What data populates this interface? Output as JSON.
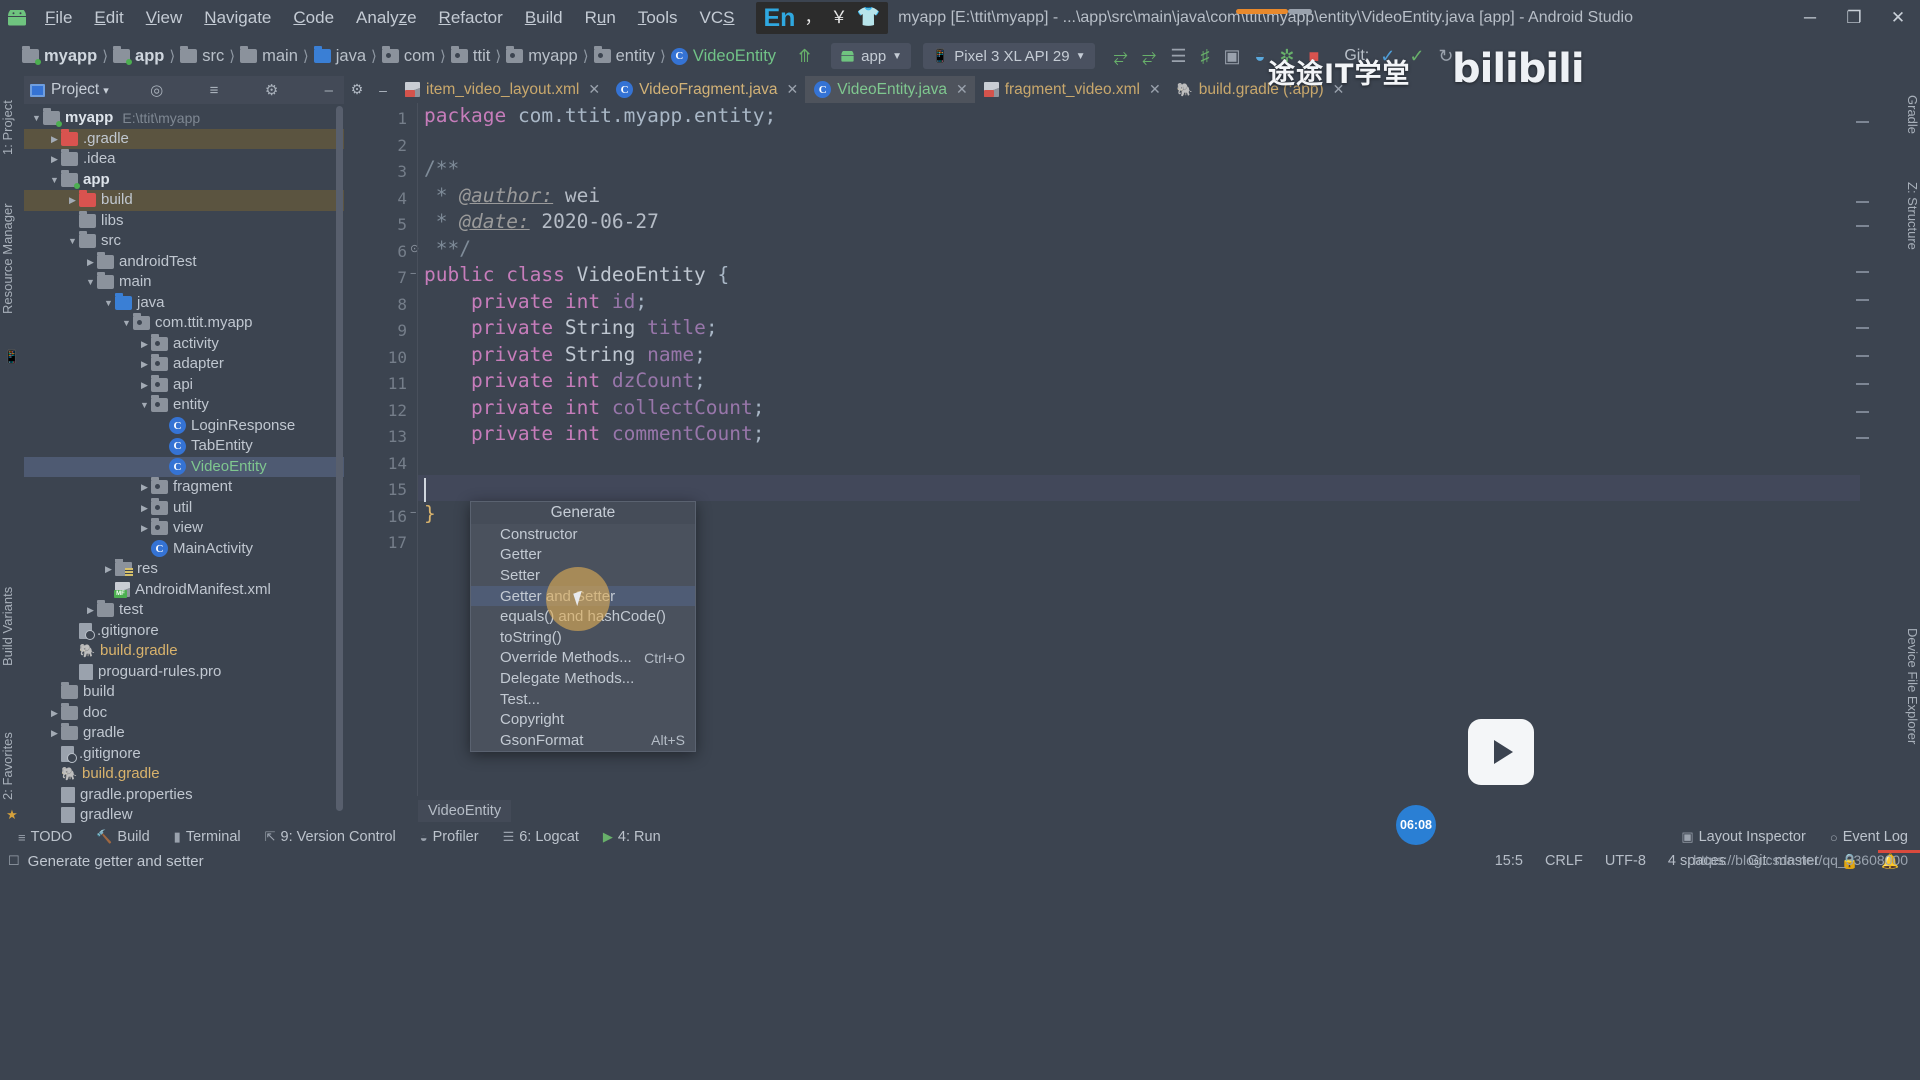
{
  "window": {
    "title": "myapp [E:\\ttit\\myapp] - ...\\app\\src\\main\\java\\com\\ttit\\myapp\\entity\\VideoEntity.java [app] - Android Studio",
    "minimize": "─",
    "maximize": "❐",
    "close": "✕",
    "logo_icon": "android-robot-icon"
  },
  "menubar": {
    "items": [
      {
        "label": "File",
        "mnemonic": "F"
      },
      {
        "label": "Edit",
        "mnemonic": "E"
      },
      {
        "label": "View",
        "mnemonic": "V"
      },
      {
        "label": "Navigate",
        "mnemonic": "N"
      },
      {
        "label": "Code",
        "mnemonic": "C"
      },
      {
        "label": "Analyze",
        "mnemonic": "z"
      },
      {
        "label": "Refactor",
        "mnemonic": "R"
      },
      {
        "label": "Build",
        "mnemonic": "B"
      },
      {
        "label": "Run",
        "mnemonic": "u"
      },
      {
        "label": "Tools",
        "mnemonic": "T"
      },
      {
        "label": "VCS",
        "mnemonic": "S"
      }
    ]
  },
  "ime": {
    "mode": "En",
    "punctuation": "，",
    "currency": "￥",
    "shape_icon": "shirt-icon"
  },
  "breadcrumb": {
    "items": [
      {
        "label": "myapp",
        "icon": "folder-module-icon",
        "bold": true
      },
      {
        "label": "app",
        "icon": "folder-module-icon",
        "bold": true
      },
      {
        "label": "src",
        "icon": "folder-icon",
        "bold": false
      },
      {
        "label": "main",
        "icon": "folder-icon",
        "bold": false
      },
      {
        "label": "java",
        "icon": "folder-source-icon",
        "bold": false
      },
      {
        "label": "com",
        "icon": "package-icon",
        "bold": false
      },
      {
        "label": "ttit",
        "icon": "package-icon",
        "bold": false
      },
      {
        "label": "myapp",
        "icon": "package-icon",
        "bold": false
      },
      {
        "label": "entity",
        "icon": "package-icon",
        "bold": false
      },
      {
        "label": "VideoEntity",
        "icon": "java-class-icon",
        "bold": false
      }
    ]
  },
  "toolbar": {
    "back_icon": "back-arrow-icon",
    "run_config": "app",
    "device": "Pixel 3 XL API 29",
    "icons": [
      "run-icon",
      "debug-icon",
      "logcat-icon",
      "profiler-icon",
      "attach-debugger-icon",
      "avd-manager-icon",
      "sdk-manager-icon",
      "stop-icon"
    ],
    "git_label": "Git:",
    "git_icons": [
      "update-project-icon",
      "commit-icon",
      "history-icon"
    ],
    "search_icon": "search-icon"
  },
  "project_panel": {
    "title": "Project",
    "title_caret": "▾",
    "header_icons": [
      "locate-icon",
      "collapse-all-icon",
      "settings-icon",
      "hide-icon"
    ],
    "tree": [
      {
        "depth": 0,
        "arrow": "▼",
        "icon": "folder-module-icon",
        "label": "myapp",
        "sub": "E:\\ttit\\myapp",
        "bold": true,
        "highlight": "none"
      },
      {
        "depth": 1,
        "arrow": "▶",
        "icon": "folder-excluded-icon",
        "label": ".gradle",
        "sub": "",
        "bold": false,
        "highlight": "tan"
      },
      {
        "depth": 1,
        "arrow": "▶",
        "icon": "folder-icon",
        "label": ".idea",
        "sub": "",
        "bold": false,
        "highlight": "none"
      },
      {
        "depth": 1,
        "arrow": "▼",
        "icon": "folder-module-icon",
        "label": "app",
        "sub": "",
        "bold": true,
        "highlight": "none"
      },
      {
        "depth": 2,
        "arrow": "▶",
        "icon": "folder-excluded-icon",
        "label": "build",
        "sub": "",
        "bold": false,
        "highlight": "tan"
      },
      {
        "depth": 2,
        "arrow": "",
        "icon": "folder-icon",
        "label": "libs",
        "sub": "",
        "bold": false,
        "highlight": "none"
      },
      {
        "depth": 2,
        "arrow": "▼",
        "icon": "folder-icon",
        "label": "src",
        "sub": "",
        "bold": false,
        "highlight": "none"
      },
      {
        "depth": 3,
        "arrow": "▶",
        "icon": "folder-icon",
        "label": "androidTest",
        "sub": "",
        "bold": false,
        "highlight": "none"
      },
      {
        "depth": 3,
        "arrow": "▼",
        "icon": "folder-icon",
        "label": "main",
        "sub": "",
        "bold": false,
        "highlight": "none"
      },
      {
        "depth": 4,
        "arrow": "▼",
        "icon": "folder-source-icon",
        "label": "java",
        "sub": "",
        "bold": false,
        "highlight": "none"
      },
      {
        "depth": 5,
        "arrow": "▼",
        "icon": "package-icon",
        "label": "com.ttit.myapp",
        "sub": "",
        "bold": false,
        "highlight": "none"
      },
      {
        "depth": 6,
        "arrow": "▶",
        "icon": "package-icon",
        "label": "activity",
        "sub": "",
        "bold": false,
        "highlight": "none"
      },
      {
        "depth": 6,
        "arrow": "▶",
        "icon": "package-icon",
        "label": "adapter",
        "sub": "",
        "bold": false,
        "highlight": "none"
      },
      {
        "depth": 6,
        "arrow": "▶",
        "icon": "package-icon",
        "label": "api",
        "sub": "",
        "bold": false,
        "highlight": "none"
      },
      {
        "depth": 6,
        "arrow": "▼",
        "icon": "package-icon",
        "label": "entity",
        "sub": "",
        "bold": false,
        "highlight": "none"
      },
      {
        "depth": 7,
        "arrow": "",
        "icon": "java-class-icon",
        "label": "LoginResponse",
        "sub": "",
        "bold": false,
        "highlight": "none"
      },
      {
        "depth": 7,
        "arrow": "",
        "icon": "java-class-icon",
        "label": "TabEntity",
        "sub": "",
        "bold": false,
        "highlight": "none"
      },
      {
        "depth": 7,
        "arrow": "",
        "icon": "java-class-icon",
        "label": "VideoEntity",
        "sub": "",
        "bold": false,
        "highlight": "selected"
      },
      {
        "depth": 6,
        "arrow": "▶",
        "icon": "package-icon",
        "label": "fragment",
        "sub": "",
        "bold": false,
        "highlight": "none"
      },
      {
        "depth": 6,
        "arrow": "▶",
        "icon": "package-icon",
        "label": "util",
        "sub": "",
        "bold": false,
        "highlight": "none"
      },
      {
        "depth": 6,
        "arrow": "▶",
        "icon": "package-icon",
        "label": "view",
        "sub": "",
        "bold": false,
        "highlight": "none"
      },
      {
        "depth": 6,
        "arrow": "",
        "icon": "java-class-icon",
        "label": "MainActivity",
        "sub": "",
        "bold": false,
        "highlight": "none"
      },
      {
        "depth": 4,
        "arrow": "▶",
        "icon": "res-folder-icon",
        "label": "res",
        "sub": "",
        "bold": false,
        "highlight": "none"
      },
      {
        "depth": 4,
        "arrow": "",
        "icon": "manifest-icon",
        "label": "AndroidManifest.xml",
        "sub": "",
        "bold": false,
        "highlight": "none"
      },
      {
        "depth": 3,
        "arrow": "▶",
        "icon": "folder-icon",
        "label": "test",
        "sub": "",
        "bold": false,
        "highlight": "none"
      },
      {
        "depth": 2,
        "arrow": "",
        "icon": "gitignore-icon",
        "label": ".gitignore",
        "sub": "",
        "bold": false,
        "highlight": "none"
      },
      {
        "depth": 2,
        "arrow": "",
        "icon": "gradle-icon",
        "label": "build.gradle",
        "sub": "",
        "bold": false,
        "highlight": "none",
        "color": "orange"
      },
      {
        "depth": 2,
        "arrow": "",
        "icon": "file-icon",
        "label": "proguard-rules.pro",
        "sub": "",
        "bold": false,
        "highlight": "none"
      },
      {
        "depth": 1,
        "arrow": "",
        "icon": "folder-icon",
        "label": "build",
        "sub": "",
        "bold": false,
        "highlight": "none"
      },
      {
        "depth": 1,
        "arrow": "▶",
        "icon": "folder-icon",
        "label": "doc",
        "sub": "",
        "bold": false,
        "highlight": "none"
      },
      {
        "depth": 1,
        "arrow": "▶",
        "icon": "folder-icon",
        "label": "gradle",
        "sub": "",
        "bold": false,
        "highlight": "none"
      },
      {
        "depth": 1,
        "arrow": "",
        "icon": "gitignore-icon",
        "label": ".gitignore",
        "sub": "",
        "bold": false,
        "highlight": "none"
      },
      {
        "depth": 1,
        "arrow": "",
        "icon": "gradle-icon",
        "label": "build.gradle",
        "sub": "",
        "bold": false,
        "highlight": "none",
        "color": "orange"
      },
      {
        "depth": 1,
        "arrow": "",
        "icon": "file-icon",
        "label": "gradle.properties",
        "sub": "",
        "bold": false,
        "highlight": "none"
      },
      {
        "depth": 1,
        "arrow": "",
        "icon": "file-icon",
        "label": "gradlew",
        "sub": "",
        "bold": false,
        "highlight": "none"
      }
    ]
  },
  "left_strips": [
    {
      "label": "1: Project"
    },
    {
      "label": "Resource Manager"
    },
    {
      "label": "Build Variants"
    },
    {
      "label": "2: Favorites"
    }
  ],
  "right_strips": [
    {
      "label": "Gradle"
    },
    {
      "label": "Z: Structure"
    },
    {
      "label": "Device File Explorer"
    }
  ],
  "editor_tabs": {
    "gear_icon": "settings-icon",
    "minimize_icon": "hide-icon",
    "tabs": [
      {
        "label": "item_video_layout.xml",
        "icon": "xml-file-icon",
        "active": false,
        "close": "✕"
      },
      {
        "label": "VideoFragment.java",
        "icon": "java-class-icon",
        "active": false,
        "close": "✕"
      },
      {
        "label": "VideoEntity.java",
        "icon": "java-class-icon",
        "active": true,
        "close": "✕"
      },
      {
        "label": "fragment_video.xml",
        "icon": "xml-file-icon",
        "active": false,
        "close": "✕"
      },
      {
        "label": "build.gradle (:app)",
        "icon": "gradle-icon",
        "active": false,
        "close": "✕"
      }
    ]
  },
  "code": {
    "line_numbers": [
      "1",
      "2",
      "3",
      "4",
      "5",
      "6",
      "7",
      "8",
      "9",
      "10",
      "11",
      "12",
      "13",
      "14",
      "15",
      "16",
      "17"
    ],
    "lines": [
      {
        "n": 1,
        "text": "package com.ttit.myapp.entity;"
      },
      {
        "n": 2,
        "text": ""
      },
      {
        "n": 3,
        "text": "/**"
      },
      {
        "n": 4,
        "text": " * @author: wei"
      },
      {
        "n": 5,
        "text": " * @date: 2020-06-27"
      },
      {
        "n": 6,
        "text": " **/"
      },
      {
        "n": 7,
        "text": "public class VideoEntity {"
      },
      {
        "n": 8,
        "text": "    private int id;"
      },
      {
        "n": 9,
        "text": "    private String title;"
      },
      {
        "n": 10,
        "text": "    private String name;"
      },
      {
        "n": 11,
        "text": "    private int dzCount;"
      },
      {
        "n": 12,
        "text": "    private int collectCount;"
      },
      {
        "n": 13,
        "text": "    private int commentCount;"
      },
      {
        "n": 14,
        "text": ""
      },
      {
        "n": 15,
        "text": ""
      },
      {
        "n": 16,
        "text": "}"
      },
      {
        "n": 17,
        "text": ""
      }
    ],
    "package_name": "com.ttit.myapp.entity",
    "class_name": "VideoEntity",
    "author": "wei",
    "date": "2020-06-27",
    "caret_line": 15,
    "file_breadcrumb": "VideoEntity"
  },
  "generate_popup": {
    "title": "Generate",
    "items": [
      {
        "label": "Constructor",
        "shortcut": "",
        "selected": false
      },
      {
        "label": "Getter",
        "shortcut": "",
        "selected": false
      },
      {
        "label": "Setter",
        "shortcut": "",
        "selected": false
      },
      {
        "label": "Getter and Setter",
        "shortcut": "",
        "selected": true
      },
      {
        "label": "equals() and hashCode()",
        "shortcut": "",
        "selected": false
      },
      {
        "label": "toString()",
        "shortcut": "",
        "selected": false
      },
      {
        "label": "Override Methods...",
        "shortcut": "Ctrl+O",
        "selected": false
      },
      {
        "label": "Delegate Methods...",
        "shortcut": "",
        "selected": false
      },
      {
        "label": "Test...",
        "shortcut": "",
        "selected": false
      },
      {
        "label": "Copyright",
        "shortcut": "",
        "selected": false
      },
      {
        "label": "GsonFormat",
        "shortcut": "Alt+S",
        "selected": false
      }
    ]
  },
  "bottom_toolbar": {
    "items": [
      {
        "label": "TODO",
        "icon": "todo-icon"
      },
      {
        "label": "Build",
        "icon": "build-hammer-icon"
      },
      {
        "label": "Terminal",
        "icon": "terminal-icon"
      },
      {
        "label": "9: Version Control",
        "icon": "vcs-icon"
      },
      {
        "label": "Profiler",
        "icon": "profiler-icon"
      },
      {
        "label": "6: Logcat",
        "icon": "logcat-icon"
      },
      {
        "label": "4: Run",
        "icon": "run-icon"
      }
    ],
    "right_items": [
      {
        "label": "Layout Inspector",
        "icon": "layout-inspector-icon"
      },
      {
        "label": "Event Log",
        "icon": "event-log-icon"
      }
    ]
  },
  "statusbar": {
    "message": "Generate getter and setter",
    "message_icon": "info-icon",
    "caret_position": "15:5",
    "line_separator": "CRLF",
    "encoding": "UTF-8",
    "indent": "4 spaces",
    "git_branch": "Git: master",
    "lock_icon": "lock-icon",
    "notification_icon": "bell-icon"
  },
  "overlays": {
    "watermark_cn": "途途IT学堂",
    "watermark_bili": "bilibili",
    "play_badge_icon": "play-button-icon",
    "time_badge": "06:08",
    "csdn_url": "https://blog.csdn.net/qq_33608000"
  }
}
